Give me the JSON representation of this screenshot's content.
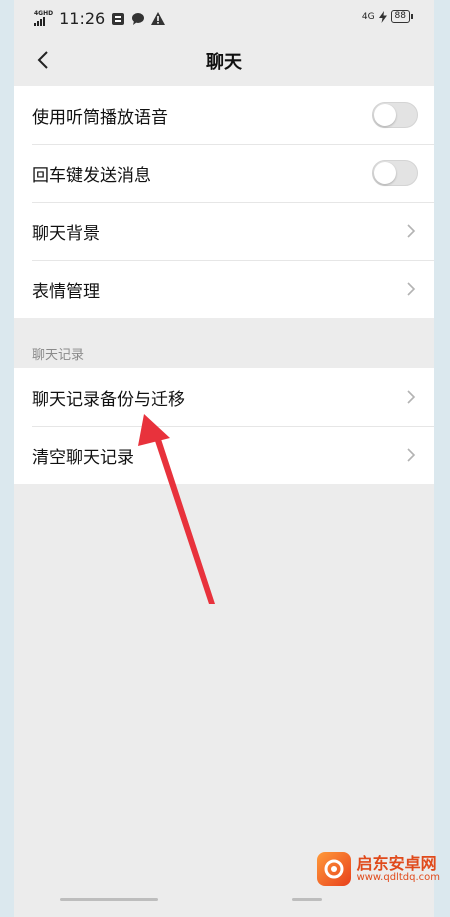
{
  "status_bar": {
    "network": "4GHD",
    "time": "11:26",
    "right_network": "4G",
    "battery": "88"
  },
  "header": {
    "title": "聊天"
  },
  "settings": [
    {
      "label": "使用听筒播放语音",
      "control": "toggle",
      "on": false
    },
    {
      "label": "回车键发送消息",
      "control": "toggle",
      "on": false
    },
    {
      "label": "聊天背景",
      "control": "chevron"
    },
    {
      "label": "表情管理",
      "control": "chevron"
    }
  ],
  "chat_history_section": {
    "title": "聊天记录",
    "items": [
      {
        "label": "聊天记录备份与迁移",
        "control": "chevron"
      },
      {
        "label": "清空聊天记录",
        "control": "chevron"
      }
    ]
  },
  "watermark": {
    "name": "启东安卓网",
    "url": "www.qdltdq.com"
  },
  "colors": {
    "page_bg": "#ececec",
    "annotation_arrow": "#e8323c",
    "watermark": "#e04a1b"
  }
}
